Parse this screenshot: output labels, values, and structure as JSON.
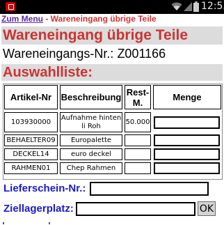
{
  "status_bar": {
    "time": "12:55",
    "icons": [
      "notification-icon",
      "wifi-icon",
      "signal-icon",
      "battery-icon"
    ]
  },
  "nav": {
    "menu_link": "Zum Menu",
    "separator": " - ",
    "current": "Wareneingang übrige Teile"
  },
  "header": {
    "title": "Wareneingang übrige Teile",
    "order_label": "Wareneingangs-Nr.:",
    "order_number": "Z001166"
  },
  "section": {
    "title": "Auswahlliste:"
  },
  "table": {
    "headers": {
      "article": "Artikel-Nr",
      "description": "Beschreibung",
      "rest": "Rest-M.",
      "quantity": "Menge"
    },
    "rows": [
      {
        "article": "103930000",
        "description": "Aufnahme hinten li Roh",
        "rest": "50.000",
        "quantity": ""
      },
      {
        "article": "BEHAELTER09",
        "description": "Europalette",
        "rest": "",
        "quantity": ""
      },
      {
        "article": "DECKEL14",
        "description": "euro deckel",
        "rest": "",
        "quantity": ""
      },
      {
        "article": "RAHMEN01",
        "description": "Chep Rahmen",
        "rest": "",
        "quantity": ""
      }
    ]
  },
  "form": {
    "delivery_note_label": "Lieferschein-Nr.:",
    "delivery_note_value": "",
    "storage_label": "Ziellagerplatz:",
    "storage_value": "",
    "ok_label": "OK"
  },
  "colors": {
    "title_red": "#cc3333",
    "link_purple": "#5b2aa0",
    "label_blue": "#1a1acc",
    "band_gray": "#dcdcdc"
  }
}
